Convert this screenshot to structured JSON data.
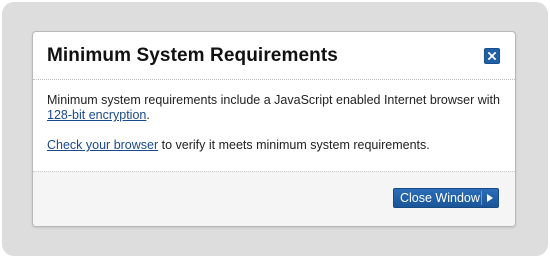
{
  "dialog": {
    "title": "Minimum System Requirements",
    "body": {
      "line1_text": "Minimum system requirements include a JavaScript enabled Internet browser with ",
      "line1_link": "128-bit encryption",
      "line1_end": ".",
      "line2_link": "Check your browser",
      "line2_text": " to verify it meets minimum system requirements."
    },
    "footer": {
      "close_button_label": "Close Window"
    }
  },
  "icons": {
    "close": "close-icon",
    "button_arrow": "triangle-right-icon"
  },
  "colors": {
    "accent": "#1f5fa5",
    "link": "#1b4a8c",
    "backdrop": "#dddddd"
  }
}
